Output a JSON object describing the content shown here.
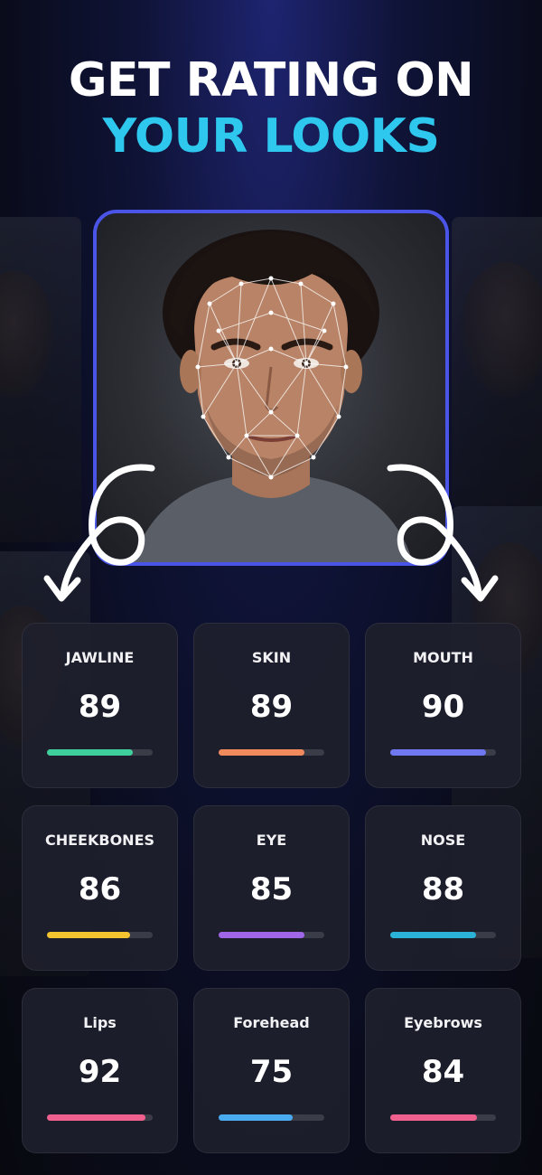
{
  "headline": {
    "line1": "GET RATING ON",
    "line2": "YOUR LOOKS"
  },
  "colors": {
    "accent": "#2ec7ee",
    "frame": "#4a55e8",
    "card_bg": "#1e202c"
  },
  "ratings": [
    {
      "label": "JAWLINE",
      "score": "89",
      "level": 0.81,
      "color": "#3fcf9c"
    },
    {
      "label": "SKIN",
      "score": "89",
      "level": 0.81,
      "color": "#f08a5d"
    },
    {
      "label": "MOUTH",
      "score": "90",
      "level": 0.91,
      "color": "#6f78f0"
    },
    {
      "label": "CHEEKBONES",
      "score": "86",
      "level": 0.79,
      "color": "#f4c430"
    },
    {
      "label": "EYE",
      "score": "85",
      "level": 0.81,
      "color": "#a066e8"
    },
    {
      "label": "NOSE",
      "score": "88",
      "level": 0.81,
      "color": "#2ab3d6"
    },
    {
      "label": "Lips",
      "score": "92",
      "level": 0.93,
      "color": "#f0608f"
    },
    {
      "label": "Forehead",
      "score": "75",
      "level": 0.7,
      "color": "#4aaaf0"
    },
    {
      "label": "Eyebrows",
      "score": "84",
      "level": 0.82,
      "color": "#f0608f"
    }
  ]
}
